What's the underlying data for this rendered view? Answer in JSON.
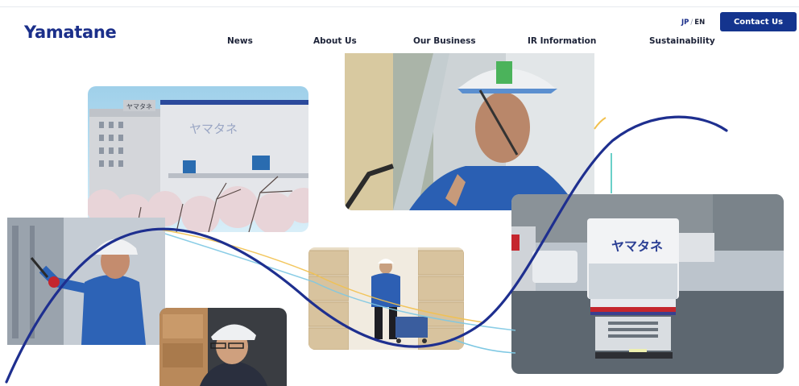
{
  "header": {
    "logo_text": "Yamatane",
    "nav": [
      {
        "label": "News"
      },
      {
        "label": "About Us"
      },
      {
        "label": "Our Business"
      },
      {
        "label": "IR Information"
      },
      {
        "label": "Sustainability"
      }
    ],
    "lang": {
      "jp": "JP",
      "separator": "/",
      "en": "EN"
    },
    "contact_label": "Contact Us"
  },
  "photos": {
    "warehouse_building_sign": "ヤマタネ",
    "truck_sign": "ヤマタネ"
  },
  "colors": {
    "brand": "#1b2f8a",
    "button": "#14348e",
    "wave_main": "#1e2f8f",
    "wave_light": "#7ec8e3",
    "wave_gold": "#f2c14e"
  }
}
